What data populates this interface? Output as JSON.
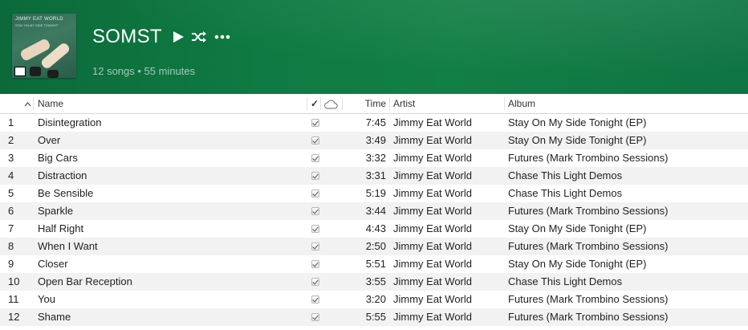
{
  "playlist": {
    "title": "SOMST",
    "summary": "12 songs • 55 minutes",
    "cover": {
      "band_text": "JIMMY EAT WORLD",
      "sub_text": "STAY ON MY SIDE TONIGHT"
    }
  },
  "table": {
    "headers": {
      "sort": "^",
      "name": "Name",
      "check": "✓",
      "time": "Time",
      "artist": "Artist",
      "album": "Album"
    },
    "rows": [
      {
        "num": "1",
        "name": "Disintegration",
        "time": "7:45",
        "artist": "Jimmy Eat World",
        "album": "Stay On My Side Tonight (EP)"
      },
      {
        "num": "2",
        "name": "Over",
        "time": "3:49",
        "artist": "Jimmy Eat World",
        "album": "Stay On My Side Tonight (EP)"
      },
      {
        "num": "3",
        "name": "Big Cars",
        "time": "3:32",
        "artist": "Jimmy Eat World",
        "album": "Futures (Mark Trombino Sessions)"
      },
      {
        "num": "4",
        "name": "Distraction",
        "time": "3:31",
        "artist": "Jimmy Eat World",
        "album": "Chase This Light Demos"
      },
      {
        "num": "5",
        "name": "Be Sensible",
        "time": "5:19",
        "artist": "Jimmy Eat World",
        "album": "Chase This Light Demos"
      },
      {
        "num": "6",
        "name": "Sparkle",
        "time": "3:44",
        "artist": "Jimmy Eat World",
        "album": "Futures (Mark Trombino Sessions)"
      },
      {
        "num": "7",
        "name": "Half Right",
        "time": "4:43",
        "artist": "Jimmy Eat World",
        "album": "Stay On My Side Tonight (EP)"
      },
      {
        "num": "8",
        "name": "When I Want",
        "time": "2:50",
        "artist": "Jimmy Eat World",
        "album": "Futures (Mark Trombino Sessions)"
      },
      {
        "num": "9",
        "name": "Closer",
        "time": "5:51",
        "artist": "Jimmy Eat World",
        "album": "Stay On My Side Tonight (EP)"
      },
      {
        "num": "10",
        "name": "Open Bar Reception",
        "time": "3:55",
        "artist": "Jimmy Eat World",
        "album": "Chase This Light Demos"
      },
      {
        "num": "11",
        "name": "You",
        "time": "3:20",
        "artist": "Jimmy Eat World",
        "album": "Futures (Mark Trombino Sessions)"
      },
      {
        "num": "12",
        "name": "Shame",
        "time": "5:55",
        "artist": "Jimmy Eat World",
        "album": "Futures (Mark Trombino Sessions)"
      }
    ]
  },
  "icons": {
    "play": "play-icon",
    "shuffle": "shuffle-icon",
    "more": "more-icon",
    "cloud": "cloud-icon",
    "sort": "sort-ascending-icon"
  },
  "colors": {
    "header_green": "#0f7a43",
    "alt_row": "#f2f2f2"
  }
}
